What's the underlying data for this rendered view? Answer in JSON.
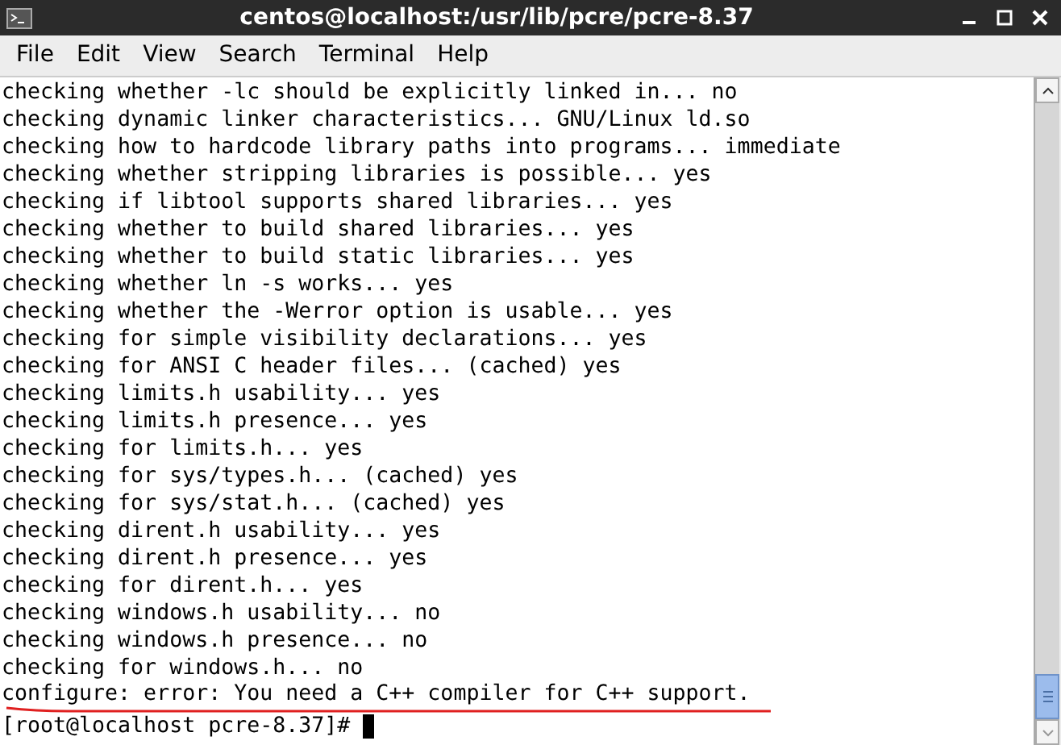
{
  "window": {
    "title": "centos@localhost:/usr/lib/pcre/pcre-8.37"
  },
  "menu": [
    "File",
    "Edit",
    "View",
    "Search",
    "Terminal",
    "Help"
  ],
  "lines": [
    "checking whether -lc should be explicitly linked in... no",
    "checking dynamic linker characteristics... GNU/Linux ld.so",
    "checking how to hardcode library paths into programs... immediate",
    "checking whether stripping libraries is possible... yes",
    "checking if libtool supports shared libraries... yes",
    "checking whether to build shared libraries... yes",
    "checking whether to build static libraries... yes",
    "checking whether ln -s works... yes",
    "checking whether the -Werror option is usable... yes",
    "checking for simple visibility declarations... yes",
    "checking for ANSI C header files... (cached) yes",
    "checking limits.h usability... yes",
    "checking limits.h presence... yes",
    "checking for limits.h... yes",
    "checking for sys/types.h... (cached) yes",
    "checking for sys/stat.h... (cached) yes",
    "checking dirent.h usability... yes",
    "checking dirent.h presence... yes",
    "checking for dirent.h... yes",
    "checking windows.h usability... no",
    "checking windows.h presence... no",
    "checking for windows.h... no"
  ],
  "error_line": "configure: error: You need a C++ compiler for C++ support.",
  "prompt": "[root@localhost pcre-8.37]#"
}
